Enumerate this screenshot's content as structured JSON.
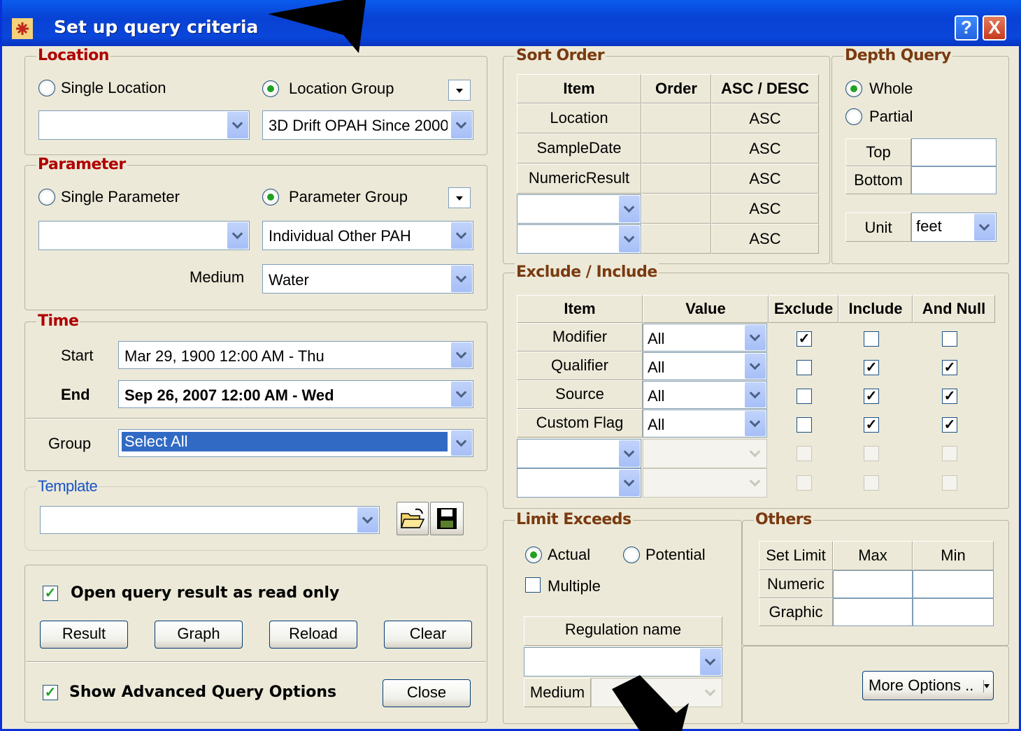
{
  "window": {
    "title": "Set up query criteria",
    "help_label": "?",
    "close_label": "X"
  },
  "location": {
    "legend": "Location",
    "single_label": "Single Location",
    "group_label": "Location Group",
    "single_value": "",
    "group_value": "3D Drift OPAH Since 2000"
  },
  "parameter": {
    "legend": "Parameter",
    "single_label": "Single Parameter",
    "group_label": "Parameter Group",
    "single_value": "",
    "group_value": "Individual Other PAH",
    "medium_label": "Medium",
    "medium_value": "Water"
  },
  "time": {
    "legend": "Time",
    "start_label": "Start",
    "start_value": "Mar 29, 1900 12:00 AM -  Thu",
    "end_label": "End",
    "end_value": "Sep 26, 2007 12:00 AM - Wed",
    "group_label": "Group",
    "group_value": "Select All"
  },
  "template": {
    "legend": "Template",
    "value": ""
  },
  "actions": {
    "readonly_label": "Open query result as read only",
    "result": "Result",
    "graph": "Graph",
    "reload": "Reload",
    "clear": "Clear",
    "advanced_label": "Show Advanced Query Options",
    "close": "Close"
  },
  "sort_order": {
    "legend": "Sort Order",
    "headers": [
      "Item",
      "Order",
      "ASC / DESC"
    ],
    "rows": [
      {
        "item": "Location",
        "order": "",
        "dir": "ASC"
      },
      {
        "item": "SampleDate",
        "order": "",
        "dir": "ASC"
      },
      {
        "item": "NumericResult",
        "order": "",
        "dir": "ASC"
      },
      {
        "item": "",
        "order": "",
        "dir": "ASC"
      },
      {
        "item": "",
        "order": "",
        "dir": "ASC"
      }
    ]
  },
  "depth": {
    "legend": "Depth Query",
    "whole": "Whole",
    "partial": "Partial",
    "top": "Top",
    "bottom": "Bottom",
    "unit_label": "Unit",
    "unit_value": "feet"
  },
  "exclude_include": {
    "legend": "Exclude / Include",
    "headers": [
      "Item",
      "Value",
      "Exclude",
      "Include",
      "And Null"
    ],
    "rows": [
      {
        "item": "Modifier",
        "value": "All",
        "exclude": true,
        "include": false,
        "and_null": false
      },
      {
        "item": "Qualifier",
        "value": "All",
        "exclude": false,
        "include": true,
        "and_null": true
      },
      {
        "item": "Source",
        "value": "All",
        "exclude": false,
        "include": true,
        "and_null": true
      },
      {
        "item": "Custom Flag",
        "value": "All",
        "exclude": false,
        "include": true,
        "and_null": true
      }
    ]
  },
  "limit_exceeds": {
    "legend": "Limit Exceeds",
    "actual": "Actual",
    "potential": "Potential",
    "multiple": "Multiple",
    "regulation_header": "Regulation name",
    "regulation_value": "",
    "medium_label": "Medium"
  },
  "others": {
    "legend": "Others",
    "headers": [
      "Set Limit",
      "Max",
      "Min"
    ],
    "rows": [
      "Numeric",
      "Graphic"
    ],
    "more_options": "More Options .."
  }
}
